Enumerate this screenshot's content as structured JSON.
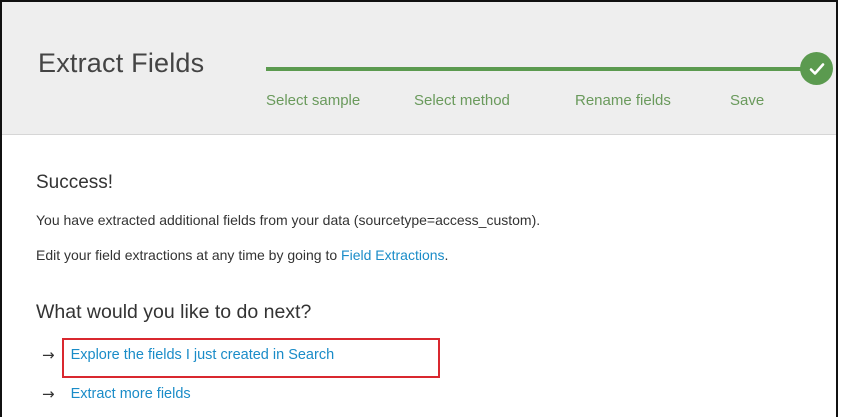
{
  "header": {
    "title": "Extract Fields",
    "steps": [
      "Select sample",
      "Select method",
      "Rename fields",
      "Save"
    ],
    "step_color": "#6a9a5c",
    "progress_color": "#5b9a4f",
    "completed_icon": "check-icon"
  },
  "main": {
    "success_title": "Success!",
    "message_1": "You have extracted additional fields from your data (sourcetype=access_custom).",
    "message_2_prefix": "Edit your field extractions at any time by going to ",
    "message_2_link": "Field Extractions",
    "message_2_suffix": ".",
    "next_title": "What would you like to do next?",
    "actions": [
      {
        "icon": "arrow-right-icon",
        "label": "Explore the fields I just created in Search",
        "highlighted": true
      },
      {
        "icon": "arrow-right-icon",
        "label": "Extract more fields",
        "highlighted": false
      }
    ],
    "link_color": "#1a8cc8",
    "highlight_color": "#d9282f"
  }
}
